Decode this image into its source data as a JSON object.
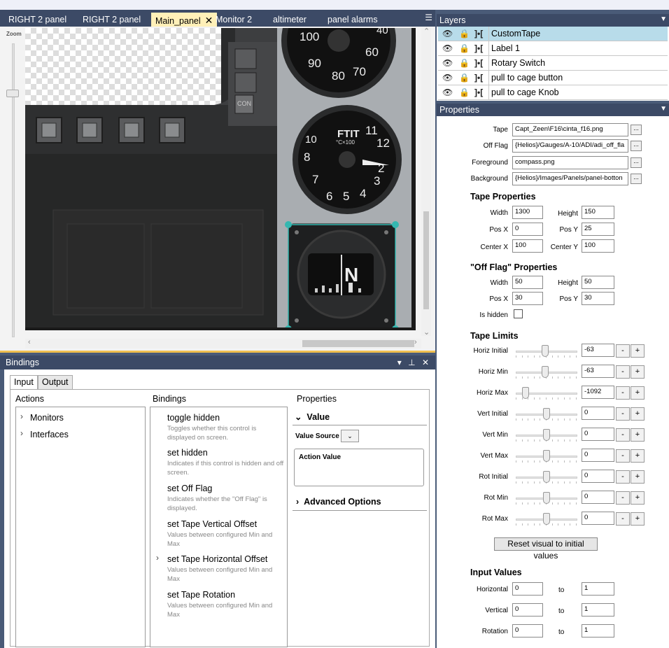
{
  "tabs": [
    {
      "label": "RIGHT 2 panel",
      "active": false
    },
    {
      "label": "RIGHT 2 panel",
      "active": false
    },
    {
      "label": "Main_panel",
      "active": true
    },
    {
      "label": "Monitor 2",
      "active": false
    },
    {
      "label": "altimeter",
      "active": false
    },
    {
      "label": "panel alarms",
      "active": false
    }
  ],
  "zoom_label": "Zoom",
  "instrument": {
    "gauge_top_numbers": [
      "100",
      "90",
      "80",
      "70",
      "60",
      "40"
    ],
    "ftit_title": "FTIT",
    "ftit_unit": "°C×100",
    "ftit_numbers": [
      "8",
      "7",
      "6",
      "5",
      "4",
      "3",
      "2",
      "12",
      "11",
      "10"
    ],
    "compass_letter": "N",
    "con_label": "CON"
  },
  "bindings": {
    "title": "Bindings",
    "tabs": [
      "Input",
      "Output"
    ],
    "actions_title": "Actions",
    "bindings_title": "Bindings",
    "properties_title": "Properties",
    "actions": [
      "Monitors",
      "Interfaces"
    ],
    "items": [
      {
        "title": "toggle hidden",
        "desc": "Toggles whether this control is displayed on screen."
      },
      {
        "title": "set hidden",
        "desc": "Indicates if this control is hidden and off screen."
      },
      {
        "title": "set Off Flag",
        "desc": "Indicates whether the \"Off Flag\" is displayed."
      },
      {
        "title": "set Tape Vertical Offset",
        "desc": "Values between configured Min and Max"
      },
      {
        "title": "set Tape Horizontal Offset",
        "desc": "Values between configured Min and Max"
      },
      {
        "title": "set Tape Rotation",
        "desc": "Values between configured Min and Max"
      }
    ],
    "value_heading": "Value",
    "value_source_label": "Value Source",
    "action_value_label": "Action Value",
    "advanced_options": "Advanced Options"
  },
  "layers": {
    "title": "Layers",
    "items": [
      "CustomTape",
      "Label 1",
      "Rotary Switch",
      "pull to cage button",
      "pull to cage Knob"
    ],
    "selected": 0
  },
  "properties": {
    "title": "Properties",
    "files": [
      {
        "label": "Tape",
        "value": "Capt_Zeen\\F16\\cinta_f16.png"
      },
      {
        "label": "Off Flag",
        "value": "{Helios}/Gauges/A-10/ADI/adi_off_fla"
      },
      {
        "label": "Foreground",
        "value": "compass.png"
      },
      {
        "label": "Background",
        "value": "{Helios}/Images/Panels/panel-botton"
      }
    ],
    "browse_label": "...",
    "tape_props_title": "Tape Properties",
    "tape_props": {
      "width_label": "Width",
      "width": "1300",
      "height_label": "Height",
      "height": "150",
      "posx_label": "Pos X",
      "posx": "0",
      "posy_label": "Pos Y",
      "posy": "25",
      "centerx_label": "Center X",
      "centerx": "100",
      "centery_label": "Center Y",
      "centery": "100"
    },
    "offflag_title": "\"Off Flag\" Properties",
    "offflag": {
      "width_label": "Width",
      "width": "50",
      "height_label": "Height",
      "height": "50",
      "posx_label": "Pos X",
      "posx": "30",
      "posy_label": "Pos Y",
      "posy": "30",
      "hidden_label": "Is hidden"
    },
    "limits_title": "Tape Limits",
    "limits": [
      {
        "label": "Horiz Initial",
        "value": "-63",
        "level": 0.47
      },
      {
        "label": "Horiz Min",
        "value": "-63",
        "level": 0.47
      },
      {
        "label": "Horiz Max",
        "value": "-1092",
        "level": 0.12
      },
      {
        "label": "Vert Initial",
        "value": "0",
        "level": 0.5
      },
      {
        "label": "Vert Min",
        "value": "0",
        "level": 0.5
      },
      {
        "label": "Vert Max",
        "value": "0",
        "level": 0.5
      },
      {
        "label": "Rot Initial",
        "value": "0",
        "level": 0.5
      },
      {
        "label": "Rot Min",
        "value": "0",
        "level": 0.5
      },
      {
        "label": "Rot Max",
        "value": "0",
        "level": 0.5
      }
    ],
    "minus_label": "-",
    "plus_label": "+",
    "reset_label": "Reset visual to initial values",
    "input_values_title": "Input Values",
    "input_values": [
      {
        "label": "Horizontal",
        "from": "0",
        "to": "1"
      },
      {
        "label": "Vertical",
        "from": "0",
        "to": "1"
      },
      {
        "label": "Rotation",
        "from": "0",
        "to": "1"
      }
    ],
    "to_label": "to"
  }
}
